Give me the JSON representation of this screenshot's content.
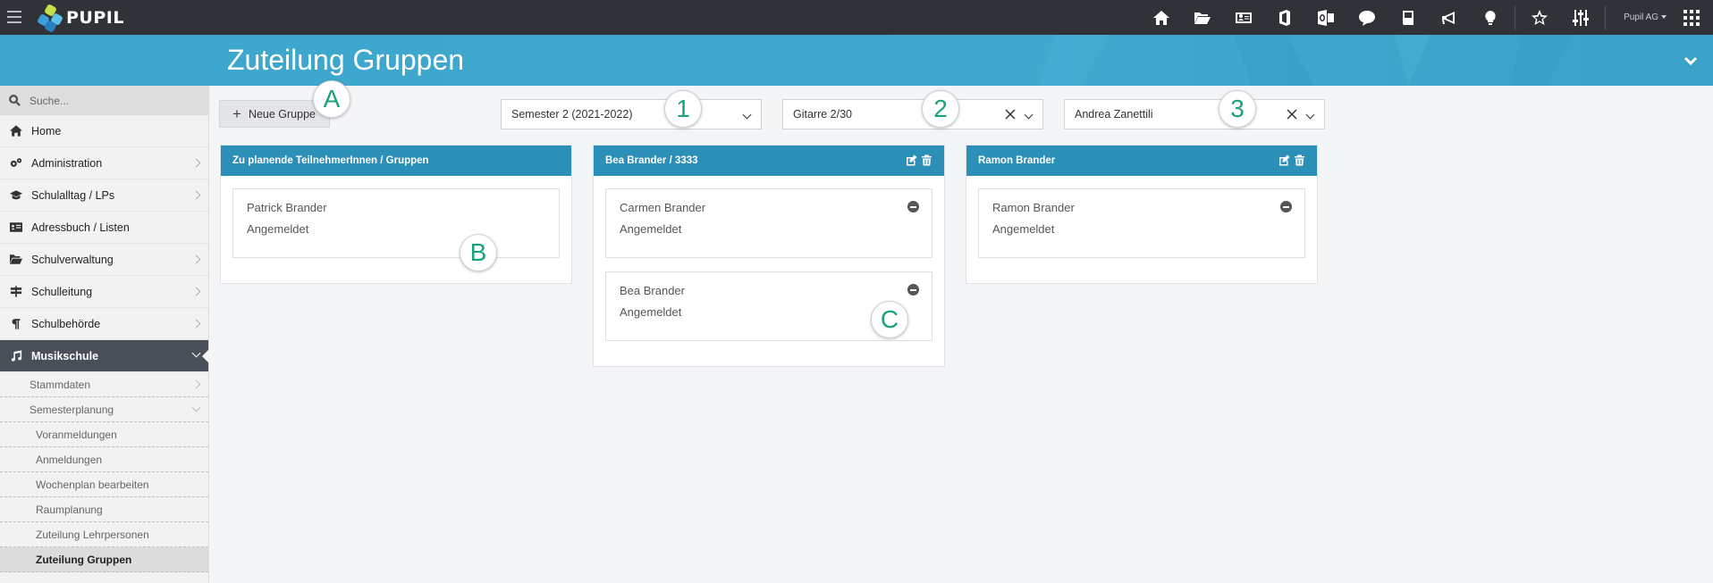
{
  "app": {
    "logo_text": "PUPIL",
    "user_label": "Pupil AG",
    "page_title": "Zuteilung Gruppen"
  },
  "top_icons": [
    "home-icon",
    "folder-open-icon",
    "address-card-icon",
    "office-icon",
    "outlook-icon",
    "chat-icon",
    "book-icon",
    "megaphone-icon",
    "lightbulb-icon",
    "star-icon",
    "sliders-icon",
    "apps-grid-icon"
  ],
  "sidebar": {
    "search_placeholder": "Suche...",
    "items": [
      {
        "label": "Home",
        "icon": "home-icon"
      },
      {
        "label": "Administration",
        "icon": "cogs-icon"
      },
      {
        "label": "Schulalltag / LPs",
        "icon": "graduation-cap-icon"
      },
      {
        "label": "Adressbuch / Listen",
        "icon": "address-card-icon"
      },
      {
        "label": "Schulverwaltung",
        "icon": "folder-open-icon"
      },
      {
        "label": "Schulleitung",
        "icon": "signpost-icon"
      },
      {
        "label": "Schulbehörde",
        "icon": "paragraph-icon"
      },
      {
        "label": "Musikschule",
        "icon": "music-icon"
      }
    ],
    "subitems": [
      {
        "label": "Stammdaten"
      },
      {
        "label": "Semesterplanung"
      },
      {
        "label": "Voranmeldungen"
      },
      {
        "label": "Anmeldungen"
      },
      {
        "label": "Wochenplan bearbeiten"
      },
      {
        "label": "Raumplanung"
      },
      {
        "label": "Zuteilung Lehrpersonen"
      },
      {
        "label": "Zuteilung Gruppen"
      }
    ]
  },
  "toolbar": {
    "new_group_label": "Neue Gruppe",
    "semester_value": "Semester 2 (2021-2022)",
    "course_value": "Gitarre 2/30",
    "teacher_value": "Andrea Zanettili"
  },
  "markers": {
    "a": "A",
    "b": "B",
    "c": "C",
    "one": "1",
    "two": "2",
    "three": "3"
  },
  "panels": [
    {
      "title": "Zu planende TeilnehmerInnen / Gruppen",
      "cards": [
        {
          "name": "Patrick Brander",
          "status": "Angemeldet"
        }
      ]
    },
    {
      "title": "Bea Brander / 3333",
      "cards": [
        {
          "name": "Carmen Brander",
          "status": "Angemeldet"
        },
        {
          "name": "Bea Brander",
          "status": "Angemeldet"
        }
      ]
    },
    {
      "title": "Ramon Brander",
      "cards": [
        {
          "name": "Ramon Brander",
          "status": "Angemeldet"
        }
      ]
    }
  ],
  "colors": {
    "topbar": "#2f3338",
    "header_band": "#3fa9cf",
    "panel_header": "#2b8fb8",
    "marker_text": "#1aa37a",
    "sidebar_active": "#4a5058"
  }
}
